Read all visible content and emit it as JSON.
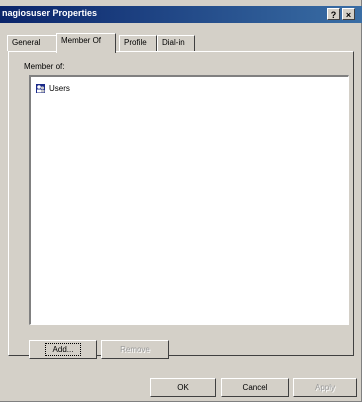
{
  "window": {
    "title": "nagiosuser Properties",
    "help_glyph": "?",
    "close_glyph": "×"
  },
  "tabs": [
    {
      "label": "General"
    },
    {
      "label": "Member Of"
    },
    {
      "label": "Profile"
    },
    {
      "label": "Dial-in"
    }
  ],
  "active_tab": "Member Of",
  "member_of": {
    "label": "Member of:",
    "items": [
      {
        "name": "Users",
        "icon": "group-icon"
      }
    ]
  },
  "list_buttons": {
    "add": "Add...",
    "remove": "Remove"
  },
  "dialog_buttons": {
    "ok": "OK",
    "cancel": "Cancel",
    "apply": "Apply"
  }
}
